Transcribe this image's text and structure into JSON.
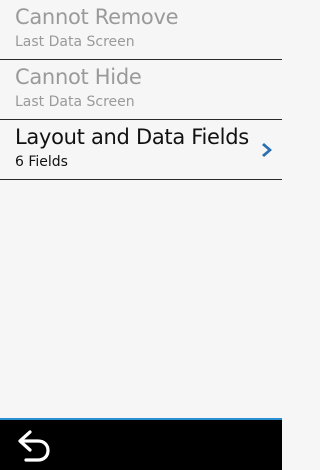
{
  "menu": {
    "items": [
      {
        "title": "Cannot Remove",
        "subtitle": "Last Data Screen"
      },
      {
        "title": "Cannot Hide",
        "subtitle": "Last Data Screen"
      },
      {
        "title": "Layout and Data Fields",
        "subtitle": "6 Fields"
      }
    ]
  },
  "icons": {
    "chevron": "chevron-right-icon",
    "back": "back-arrow-icon"
  },
  "colors": {
    "accent": "#2a8fd0",
    "disabled_text": "#9a9a9a",
    "active_text": "#111111",
    "background": "#f6f6f6",
    "bottom_bar": "#000000"
  }
}
